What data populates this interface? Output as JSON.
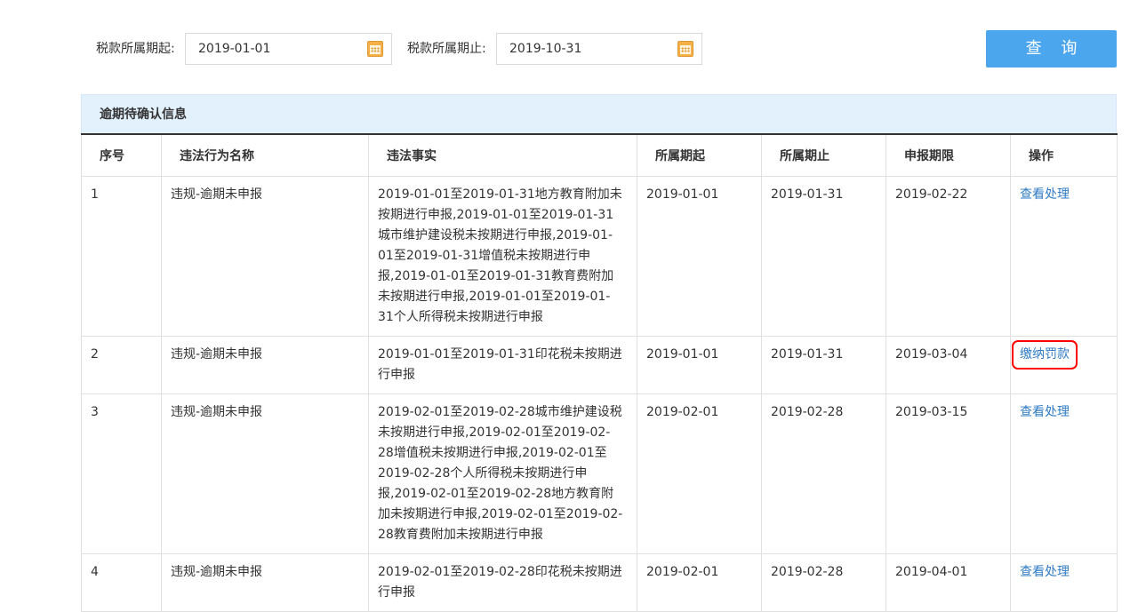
{
  "filters": {
    "start_label": "税款所属期起:",
    "start_value": "2019-01-01",
    "end_label": "税款所属期止:",
    "end_value": "2019-10-31",
    "query_button": "查 询"
  },
  "panel": {
    "title": "逾期待确认信息",
    "columns": [
      "序号",
      "违法行为名称",
      "违法事实",
      "所属期起",
      "所属期止",
      "申报期限",
      "操作"
    ],
    "rows": [
      {
        "no": "1",
        "name": "违规-逾期未申报",
        "fact": "2019-01-01至2019-01-31地方教育附加未按期进行申报,2019-01-01至2019-01-31城市维护建设税未按期进行申报,2019-01-01至2019-01-31增值税未按期进行申报,2019-01-01至2019-01-31教育费附加未按期进行申报,2019-01-01至2019-01-31个人所得税未按期进行申报",
        "period_start": "2019-01-01",
        "period_end": "2019-01-31",
        "deadline": "2019-02-22",
        "action": "查看处理"
      },
      {
        "no": "2",
        "name": "违规-逾期未申报",
        "fact": "2019-01-01至2019-01-31印花税未按期进行申报",
        "period_start": "2019-01-01",
        "period_end": "2019-01-31",
        "deadline": "2019-03-04",
        "action": "缴纳罚款"
      },
      {
        "no": "3",
        "name": "违规-逾期未申报",
        "fact": "2019-02-01至2019-02-28城市维护建设税未按期进行申报,2019-02-01至2019-02-28增值税未按期进行申报,2019-02-01至2019-02-28个人所得税未按期进行申报,2019-02-01至2019-02-28地方教育附加未按期进行申报,2019-02-01至2019-02-28教育费附加未按期进行申报",
        "period_start": "2019-02-01",
        "period_end": "2019-02-28",
        "deadline": "2019-03-15",
        "action": "查看处理"
      },
      {
        "no": "4",
        "name": "违规-逾期未申报",
        "fact": "2019-02-01至2019-02-28印花税未按期进行申报",
        "period_start": "2019-02-01",
        "period_end": "2019-02-28",
        "deadline": "2019-04-01",
        "action": "查看处理"
      }
    ]
  },
  "colors": {
    "accent": "#4ba6ee",
    "link": "#2f7bc4",
    "highlight_border": "#ff0000",
    "panel_header_bg": "#e3f1fd"
  }
}
